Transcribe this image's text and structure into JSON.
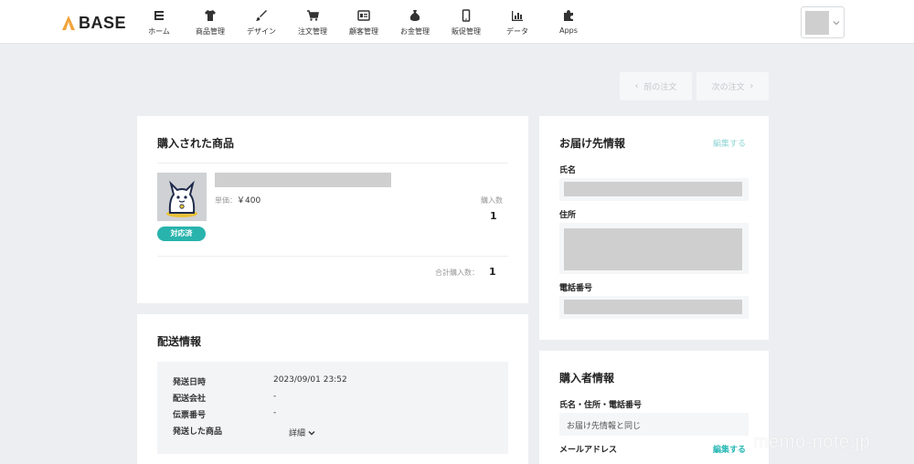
{
  "brand": {
    "name": "BASE"
  },
  "nav": {
    "items": [
      {
        "label": "ホーム",
        "icon": "home-list-icon"
      },
      {
        "label": "商品管理",
        "icon": "tshirt-icon"
      },
      {
        "label": "デザイン",
        "icon": "brush-icon"
      },
      {
        "label": "注文管理",
        "icon": "cart-icon"
      },
      {
        "label": "顧客管理",
        "icon": "id-card-icon"
      },
      {
        "label": "お金管理",
        "icon": "money-bag-icon"
      },
      {
        "label": "販促管理",
        "icon": "smartphone-icon"
      },
      {
        "label": "データ",
        "icon": "bar-chart-icon"
      },
      {
        "label": "Apps",
        "icon": "puzzle-icon"
      }
    ]
  },
  "order_nav": {
    "prev_label": "前の注文",
    "next_label": "次の注文"
  },
  "purchased": {
    "title": "購入された商品",
    "unit_price_label": "単価：",
    "unit_price": "￥400",
    "qty_label": "購入数",
    "qty": "1",
    "status_badge": "対応済",
    "total_label": "合計購入数：",
    "total": "1"
  },
  "shipping": {
    "title": "配送情報",
    "rows": [
      {
        "key": "発送日時",
        "value": "2023/09/01 23:52"
      },
      {
        "key": "配送会社",
        "value": "-"
      },
      {
        "key": "伝票番号",
        "value": "-"
      },
      {
        "key": "発送した商品",
        "value": "詳細"
      }
    ]
  },
  "delivery": {
    "title": "お届け先情報",
    "edit_label": "編集する",
    "name_label": "氏名",
    "address_label": "住所",
    "phone_label": "電話番号"
  },
  "buyer": {
    "title": "購入者情報",
    "combined_label": "氏名・住所・電話番号",
    "combined_value": "お届け先情報と同じ",
    "email_label": "メールアドレス",
    "edit_label": "編集する"
  },
  "watermark": "memo-note.jp",
  "colors": {
    "accent": "#29b3ad",
    "background": "#eceef1",
    "placeholder": "#cfcfcf"
  }
}
